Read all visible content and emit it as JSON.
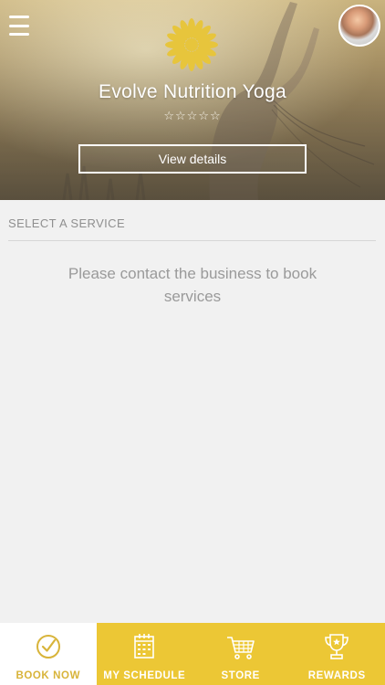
{
  "app": {
    "business_name": "Evolve Nutrition Yoga",
    "rating_stars": "☆☆☆☆☆",
    "view_details_label": "View details",
    "colors": {
      "accent": "#ecc735",
      "accent_dark": "#d8b43a",
      "logo": "#e7c53c",
      "background": "#f1f1f1"
    }
  },
  "header": {
    "menu_icon": "hamburger-menu-icon",
    "avatar": "user-avatar",
    "logo_icon": "lotus-flower-icon"
  },
  "main": {
    "section_title": "SELECT A SERVICE",
    "empty_message": "Please contact the business to book services"
  },
  "nav": {
    "items": [
      {
        "label": "BOOK NOW",
        "icon": "check-circle-icon",
        "active": true
      },
      {
        "label": "MY SCHEDULE",
        "icon": "calendar-icon",
        "active": false
      },
      {
        "label": "STORE",
        "icon": "shopping-cart-icon",
        "active": false
      },
      {
        "label": "REWARDS",
        "icon": "trophy-icon",
        "active": false
      }
    ]
  }
}
